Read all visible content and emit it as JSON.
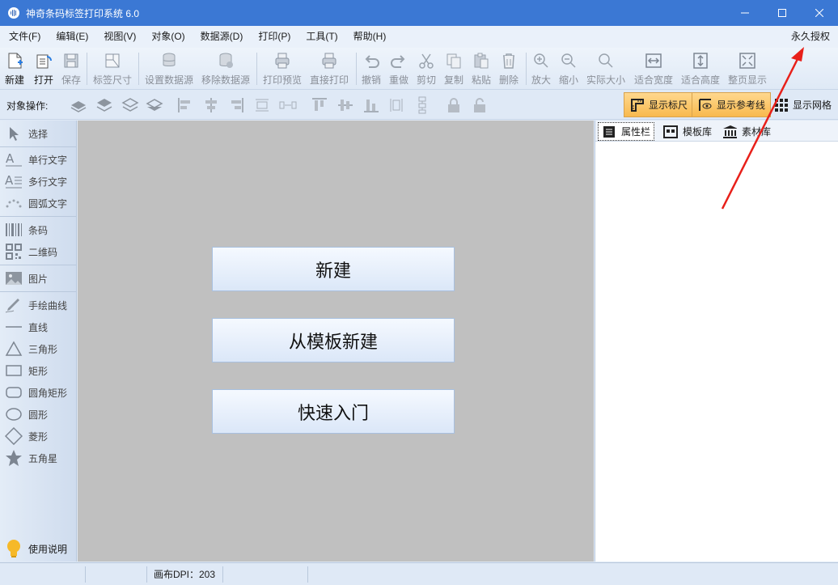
{
  "window": {
    "title": "神奇条码标签打印系统 6.0"
  },
  "menu": {
    "items": [
      "文件(F)",
      "编辑(E)",
      "视图(V)",
      "对象(O)",
      "数据源(D)",
      "打印(P)",
      "工具(T)",
      "帮助(H)"
    ],
    "license": "永久授权"
  },
  "toolbar": {
    "new": "新建",
    "open": "打开",
    "save": "保存",
    "label_size": "标签尺寸",
    "set_datasource": "设置数据源",
    "remove_datasource": "移除数据源",
    "print_preview": "打印预览",
    "direct_print": "直接打印",
    "undo": "撤销",
    "redo": "重做",
    "cut": "剪切",
    "copy": "复制",
    "paste": "粘贴",
    "delete": "删除",
    "zoom_in": "放大",
    "zoom_out": "缩小",
    "actual_size": "实际大小",
    "fit_width": "适合宽度",
    "fit_height": "适合高度",
    "fit_page": "整页显示"
  },
  "objbar": {
    "label": "对象操作:",
    "show_ruler": "显示标尺",
    "show_guides": "显示参考线",
    "show_grid": "显示网格"
  },
  "tools": {
    "select": "选择",
    "single_text": "单行文字",
    "multi_text": "多行文字",
    "arc_text": "圆弧文字",
    "barcode": "条码",
    "qrcode": "二维码",
    "image": "图片",
    "freehand": "手绘曲线",
    "line": "直线",
    "triangle": "三角形",
    "rect": "矩形",
    "round_rect": "圆角矩形",
    "ellipse": "圆形",
    "diamond": "菱形",
    "star": "五角星",
    "help": "使用说明"
  },
  "start": {
    "new": "新建",
    "from_template": "从模板新建",
    "quick_start": "快速入门"
  },
  "panel_tabs": {
    "properties": "属性栏",
    "templates": "模板库",
    "assets": "素材库"
  },
  "status": {
    "dpi": "画布DPI：203"
  },
  "colors": {
    "titlebar": "#3b78d4",
    "canvas": "#c0c0c0",
    "toggle_on": "#f8b94e",
    "annotation_arrow": "#e8201a"
  }
}
